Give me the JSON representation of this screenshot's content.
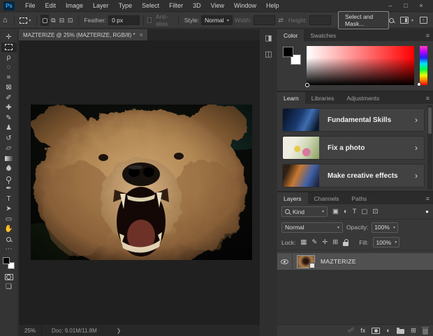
{
  "app": {
    "logo_text": "Ps"
  },
  "menu": {
    "items": [
      "File",
      "Edit",
      "Image",
      "Layer",
      "Type",
      "Select",
      "Filter",
      "3D",
      "View",
      "Window",
      "Help"
    ]
  },
  "window_controls": {
    "minimize": "–",
    "maximize": "□",
    "close": "×"
  },
  "options_bar": {
    "feather_label": "Feather:",
    "feather_value": "0 px",
    "antialias_label": "Anti-alias",
    "style_label": "Style:",
    "style_value": "Normal",
    "width_label": "Width:",
    "width_value": "",
    "height_label": "Height:",
    "height_value": "",
    "select_and_mask_label": "Select and Mask..."
  },
  "document": {
    "tab_title": "MAZTERIZE @ 25% (MAZTERIZE, RGB/8) *",
    "zoom_level": "25%",
    "doc_size": "Doc: 9.01M/11.8M"
  },
  "panels": {
    "color": {
      "tabs": [
        "Color",
        "Swatches"
      ],
      "active_tab": "Color"
    },
    "learn": {
      "tabs": [
        "Learn",
        "Libraries",
        "Adjustments"
      ],
      "active_tab": "Learn",
      "cards": [
        {
          "title": "Fundamental Skills"
        },
        {
          "title": "Fix a photo"
        },
        {
          "title": "Make creative effects"
        }
      ]
    },
    "layers": {
      "tabs": [
        "Layers",
        "Channels",
        "Paths"
      ],
      "active_tab": "Layers",
      "filter_kind": "Kind",
      "blend_mode": "Normal",
      "opacity_label": "Opacity:",
      "opacity_value": "100%",
      "lock_label": "Lock:",
      "fill_label": "Fill:",
      "fill_value": "100%",
      "fx_label": "fx",
      "layer": {
        "name": "MAZTERIZE",
        "visible": true,
        "selected": true,
        "type": "smart-object"
      }
    }
  },
  "tools": [
    {
      "name": "move-tool",
      "glyph": "✛"
    },
    {
      "name": "lasso-tool",
      "glyph": "ρ"
    },
    {
      "name": "quick-selection-tool",
      "glyph": "◌"
    },
    {
      "name": "crop-tool",
      "glyph": "⌗"
    },
    {
      "name": "frame-tool",
      "glyph": "⊠"
    },
    {
      "name": "eyedropper-tool",
      "glyph": "✐"
    },
    {
      "name": "spot-healing-brush-tool",
      "glyph": "✚"
    },
    {
      "name": "brush-tool",
      "glyph": "✎"
    },
    {
      "name": "clone-stamp-tool",
      "glyph": "♟"
    },
    {
      "name": "history-brush-tool",
      "glyph": "↺"
    },
    {
      "name": "eraser-tool",
      "glyph": "▱"
    },
    {
      "name": "pen-tool",
      "glyph": "✒"
    },
    {
      "name": "type-tool",
      "glyph": "T"
    },
    {
      "name": "path-selection-tool",
      "glyph": "➤"
    },
    {
      "name": "rectangle-tool",
      "glyph": "▭"
    },
    {
      "name": "hand-tool",
      "glyph": "✋"
    },
    {
      "name": "toolbar-ellipsis",
      "glyph": "⋯"
    },
    {
      "name": "screen-mode",
      "glyph": "❏"
    }
  ],
  "icons": {
    "home": "⌂",
    "dropdown": "▾",
    "hamburger": "≡",
    "chevron_right": "›",
    "status_chevron": "❯",
    "tab_close": "×",
    "link_fields": "⇄",
    "link_layers": "☍",
    "mode_new": "▢",
    "mode_add": "⧉",
    "mode_subtract": "⊟",
    "mode_intersect": "⊡",
    "collapsed_panel_1": "◨",
    "collapsed_panel_2": "◫",
    "filter_pixel": "▣",
    "filter_adjustment": "◐",
    "filter_type": "T",
    "filter_shape": "▢",
    "filter_smart_object": "⊡",
    "toggle_dot": "●",
    "lock_transparent": "▦",
    "lock_paint": "✎",
    "lock_move": "✛",
    "lock_artboard": "⊞",
    "adjustment_layer": "◐",
    "new_layer": "⊞"
  },
  "colors": {
    "accent_blue": "#31a8ff",
    "panel_bg": "#383838",
    "pasteboard": "#202020",
    "selected_layer_row": "#505050",
    "color_panel_hue": "#ff0000"
  }
}
